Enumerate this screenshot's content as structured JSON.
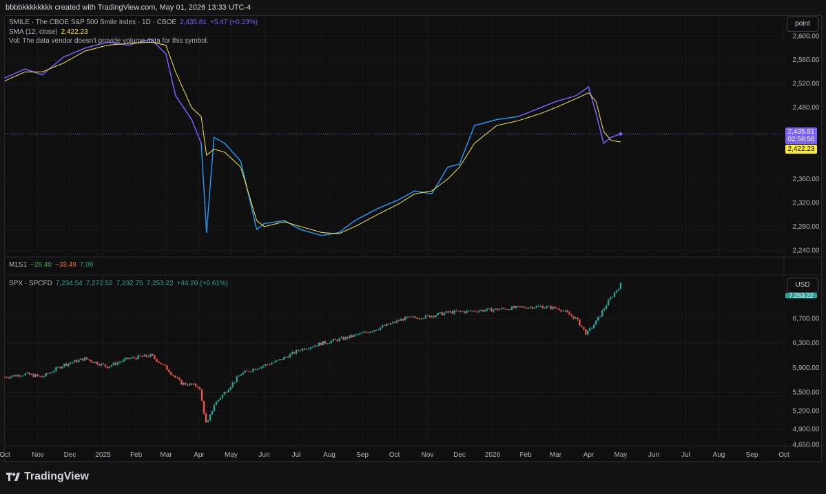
{
  "header": {
    "title": "bbbbkkkkkkkk created with TradingView.com, May 01, 2026 13:33 UTC-4"
  },
  "pane1": {
    "symbol_title": "SMILE · The CBOE S&P 500 Smile Index · 1D · CBOE",
    "price": "2,435.81",
    "change": "+5.47 (+0.23%)",
    "sma_label": "SMA (12, close)",
    "sma_value": "2,422.23",
    "vol_note": "Vol: The data vendor doesn't provide volume data for this symbol.",
    "scale_button": "point",
    "price_tag": "2,435.81",
    "countdown": "02:56:56",
    "sma_tag": "2,422.23",
    "yticks": [
      "2,600.00",
      "2,560.00",
      "2,520.00",
      "2,480.00",
      "2,360.00",
      "2,320.00",
      "2,280.00",
      "2,240.00"
    ]
  },
  "indicator": {
    "label": "M1S1",
    "v1": "−26.40",
    "v2": "−33.49",
    "v3": "7.09"
  },
  "pane2": {
    "symbol_title": "SPX · SPCFD",
    "open": "7,234.54",
    "high": "7,272.52",
    "low": "7,232.75",
    "close": "7,253.22",
    "change": "+44.20 (+0.61%)",
    "scale_button": "USD",
    "price_tag": "7,253.22",
    "yticks": [
      "6,700.00",
      "6,300.00",
      "5,900.00",
      "5,500.00",
      "5,200.00",
      "4,900.00",
      "4,650.00"
    ]
  },
  "xaxis": {
    "labels": [
      "Oct",
      "Nov",
      "Dec",
      "2025",
      "Feb",
      "Mar",
      "Apr",
      "May",
      "Jun",
      "Jul",
      "Aug",
      "Sep",
      "Oct",
      "Nov",
      "Dec",
      "2026",
      "Feb",
      "Mar",
      "Apr",
      "May",
      "Jun",
      "Jul",
      "Aug",
      "Sep",
      "Oct"
    ]
  },
  "branding": {
    "logo_text": "TradingView"
  },
  "colors": {
    "smile_purple": "#7b61ff",
    "smile_blue": "#2196f3",
    "sma_yellow": "#ffeb3b",
    "up": "#26a69a",
    "down": "#ef5350",
    "background": "#0f0f0f"
  },
  "chart_data": [
    {
      "type": "line",
      "title": "SMILE · The CBOE S&P 500 Smile Index · 1D · CBOE",
      "x": [
        "2024-10-01",
        "2024-10-20",
        "2024-11-05",
        "2024-11-25",
        "2024-12-15",
        "2025-01-05",
        "2025-01-25",
        "2025-02-15",
        "2025-03-01",
        "2025-03-10",
        "2025-03-25",
        "2025-04-03",
        "2025-04-08",
        "2025-04-15",
        "2025-04-25",
        "2025-05-10",
        "2025-05-25",
        "2025-06-01",
        "2025-06-20",
        "2025-07-05",
        "2025-07-25",
        "2025-08-10",
        "2025-08-25",
        "2025-09-15",
        "2025-10-05",
        "2025-10-20",
        "2025-11-05",
        "2025-11-20",
        "2025-12-01",
        "2025-12-15",
        "2026-01-05",
        "2026-01-25",
        "2026-02-15",
        "2026-03-01",
        "2026-03-20",
        "2026-04-01",
        "2026-04-08",
        "2026-04-15",
        "2026-04-22",
        "2026-05-01"
      ],
      "series": [
        {
          "name": "SMILE",
          "values": [
            2530,
            2545,
            2535,
            2565,
            2580,
            2590,
            2585,
            2595,
            2570,
            2500,
            2460,
            2420,
            2270,
            2430,
            2420,
            2390,
            2275,
            2285,
            2290,
            2275,
            2265,
            2270,
            2290,
            2310,
            2325,
            2340,
            2335,
            2380,
            2385,
            2450,
            2460,
            2465,
            2480,
            2490,
            2500,
            2515,
            2470,
            2420,
            2430,
            2435.81
          ]
        },
        {
          "name": "SMA (12, close)",
          "values": [
            2525,
            2540,
            2540,
            2555,
            2575,
            2585,
            2588,
            2590,
            2585,
            2540,
            2480,
            2465,
            2400,
            2410,
            2405,
            2380,
            2290,
            2280,
            2288,
            2280,
            2270,
            2268,
            2280,
            2300,
            2318,
            2335,
            2340,
            2360,
            2380,
            2420,
            2450,
            2458,
            2470,
            2480,
            2495,
            2505,
            2490,
            2440,
            2425,
            2422.23
          ]
        }
      ],
      "ylim": [
        2230,
        2610
      ],
      "yticks": [
        2240,
        2280,
        2320,
        2360,
        2480,
        2520,
        2560,
        2600
      ],
      "last_price": 2435.81,
      "sma_last": 2422.23
    },
    {
      "type": "line",
      "title": "SPX · SPCFD",
      "x": [
        "2024-10-01",
        "2024-10-20",
        "2024-11-05",
        "2024-11-25",
        "2024-12-15",
        "2025-01-05",
        "2025-01-25",
        "2025-02-15",
        "2025-03-01",
        "2025-03-15",
        "2025-04-01",
        "2025-04-08",
        "2025-04-15",
        "2025-04-25",
        "2025-05-10",
        "2025-05-25",
        "2025-06-15",
        "2025-07-05",
        "2025-07-25",
        "2025-08-15",
        "2025-09-05",
        "2025-09-25",
        "2025-10-10",
        "2025-10-30",
        "2025-11-20",
        "2025-12-10",
        "2026-01-05",
        "2026-01-25",
        "2026-02-15",
        "2026-03-05",
        "2026-03-20",
        "2026-03-30",
        "2026-04-08",
        "2026-04-20",
        "2026-05-01"
      ],
      "series": [
        {
          "name": "SPX",
          "values": [
            5750,
            5800,
            5750,
            5950,
            6050,
            5920,
            6050,
            6100,
            5900,
            5650,
            5600,
            4950,
            5300,
            5500,
            5800,
            5900,
            6020,
            6200,
            6300,
            6380,
            6480,
            6600,
            6700,
            6730,
            6800,
            6820,
            6850,
            6880,
            6900,
            6860,
            6700,
            6450,
            6650,
            7000,
            7253.22
          ]
        }
      ],
      "ylim": [
        4620,
        7400
      ],
      "yticks": [
        4650,
        4900,
        5200,
        5500,
        5900,
        6300,
        6700
      ],
      "ohlc_last": {
        "open": 7234.54,
        "high": 7272.52,
        "low": 7232.75,
        "close": 7253.22
      }
    }
  ]
}
